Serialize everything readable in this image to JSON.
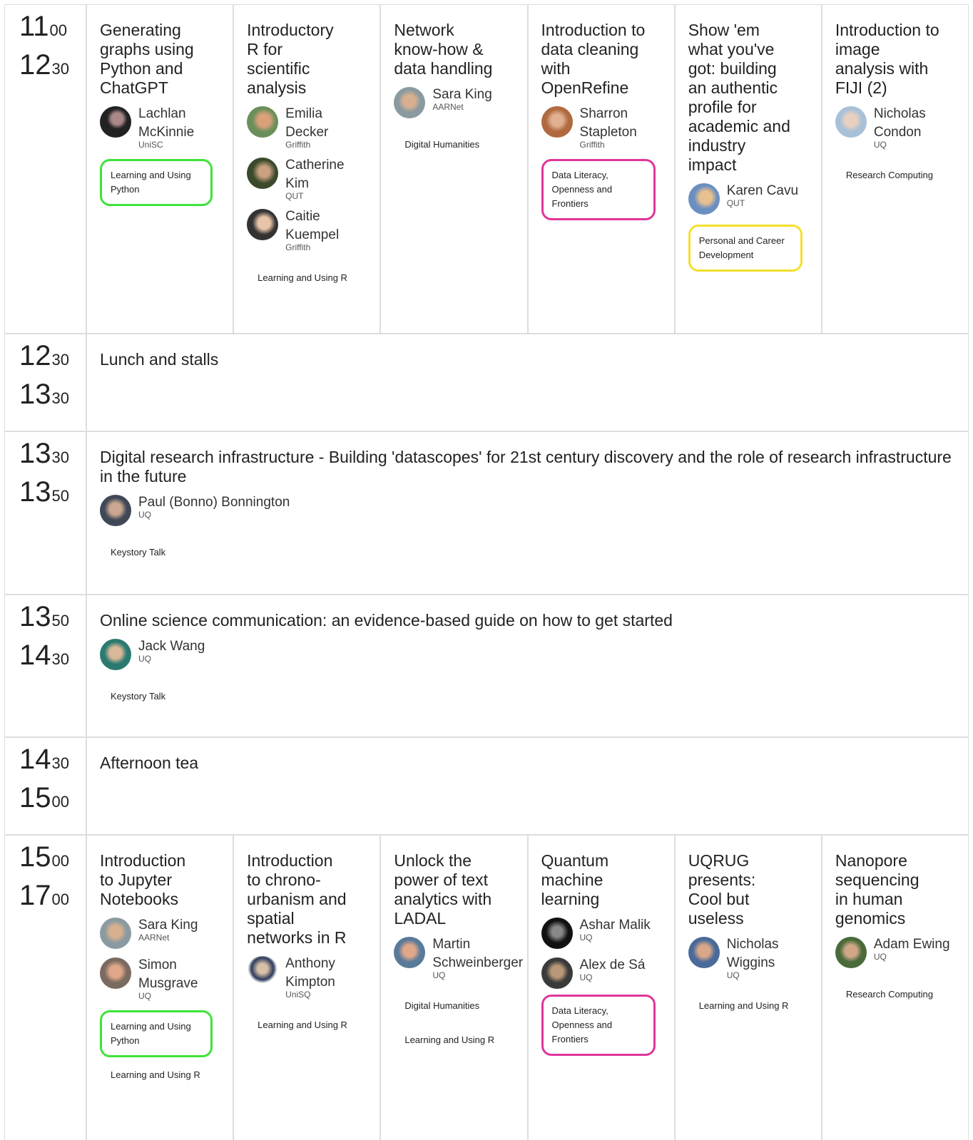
{
  "rows": {
    "r1": {
      "start_h": "11",
      "start_m": "00",
      "end_h": "12",
      "end_m": "30",
      "sessions": [
        {
          "title": "Generating graphs using Python and ChatGPT",
          "speakers": [
            {
              "name": "Lachlan McKinnie",
              "aff": "UniSC"
            }
          ],
          "tags": [
            "Learning and Using Python"
          ]
        },
        {
          "title": "Introductory R for scientific analysis",
          "speakers": [
            {
              "name": "Emilia Decker",
              "aff": "Griffith"
            },
            {
              "name": "Catherine Kim",
              "aff": "QUT"
            },
            {
              "name": "Caitie Kuempel",
              "aff": "Griffith"
            }
          ],
          "tags": [
            "Learning and Using R"
          ]
        },
        {
          "title": "Network know-how & data handling",
          "speakers": [
            {
              "name": "Sara King",
              "aff": "AARNet"
            }
          ],
          "tags": [
            "Digital Humanities"
          ]
        },
        {
          "title": "Introduction to data cleaning with OpenRefine",
          "speakers": [
            {
              "name": "Sharron Stapleton",
              "aff": "Griffith"
            }
          ],
          "tags": [
            "Data Literacy, Openness and Frontiers"
          ]
        },
        {
          "title": "Show 'em what you've got: building an authentic profile for academic and industry impact",
          "speakers": [
            {
              "name": "Karen Cavu",
              "aff": "QUT"
            }
          ],
          "tags": [
            "Personal and Career Development"
          ]
        },
        {
          "title": "Introduction to image analysis with FIJI (2)",
          "speakers": [
            {
              "name": "Nicholas Condon",
              "aff": "UQ"
            }
          ],
          "tags": [
            "Research Computing"
          ]
        }
      ]
    },
    "r2": {
      "start_h": "12",
      "start_m": "30",
      "end_h": "13",
      "end_m": "30",
      "title": "Lunch and stalls"
    },
    "r3": {
      "start_h": "13",
      "start_m": "30",
      "end_h": "13",
      "end_m": "50",
      "title": "Digital research infrastructure - Building 'datascopes' for 21st century discovery and the role of research infrastructure in the future",
      "speaker": {
        "name": "Paul (Bonno) Bonnington",
        "aff": "UQ"
      },
      "tag": "Keystory Talk"
    },
    "r4": {
      "start_h": "13",
      "start_m": "50",
      "end_h": "14",
      "end_m": "30",
      "title": "Online science communication: an evidence-based guide on how to get started",
      "speaker": {
        "name": "Jack Wang",
        "aff": "UQ"
      },
      "tag": "Keystory Talk"
    },
    "r5": {
      "start_h": "14",
      "start_m": "30",
      "end_h": "15",
      "end_m": "00",
      "title": "Afternoon tea"
    },
    "r6": {
      "start_h": "15",
      "start_m": "00",
      "end_h": "17",
      "end_m": "00",
      "sessions": [
        {
          "title": "Introduction to Jupyter Notebooks",
          "speakers": [
            {
              "name": "Sara King",
              "aff": "AARNet"
            },
            {
              "name": "Simon Musgrave",
              "aff": "UQ"
            }
          ],
          "tags": [
            "Learning and Using Python",
            "Learning and Using R"
          ]
        },
        {
          "title": "Introduction to chrono-urbanism and spatial networks in R",
          "speakers": [
            {
              "name": "Anthony Kimpton",
              "aff": "UniSQ"
            }
          ],
          "tags": [
            "Learning and Using R"
          ]
        },
        {
          "title": "Unlock the power of text analytics with LADAL",
          "speakers": [
            {
              "name": "Martin Schweinberger",
              "aff": "UQ"
            }
          ],
          "tags": [
            "Digital Humanities",
            "Learning and Using R"
          ]
        },
        {
          "title": "Quantum machine learning",
          "speakers": [
            {
              "name": "Ashar Malik",
              "aff": "UQ"
            },
            {
              "name": "Alex de Sá",
              "aff": "UQ"
            }
          ],
          "tags": [
            "Data Literacy, Openness and Frontiers"
          ]
        },
        {
          "title": "UQRUG presents: Cool but useless",
          "speakers": [
            {
              "name": "Nicholas Wiggins",
              "aff": "UQ"
            }
          ],
          "tags": [
            "Learning and Using R"
          ]
        },
        {
          "title": "Nanopore sequencing in human genomics",
          "speakers": [
            {
              "name": "Adam Ewing",
              "aff": "UQ"
            }
          ],
          "tags": [
            "Research Computing"
          ]
        }
      ]
    }
  },
  "colors": {
    "python": "#3ee33a",
    "data_literacy": "#e0359a",
    "career": "#f5df2e",
    "grid": "#dddddd"
  }
}
